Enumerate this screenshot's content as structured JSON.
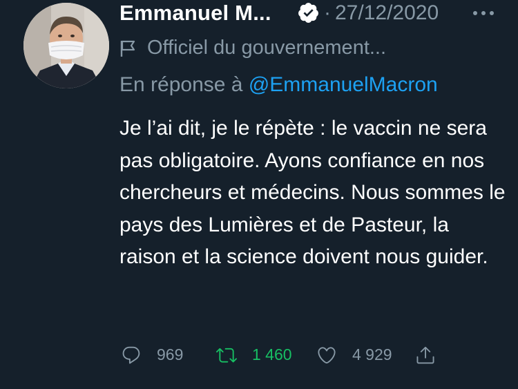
{
  "tweet": {
    "author_name": "Emmanuel M...",
    "date": "27/12/2020",
    "separator": "·",
    "government_label": "Officiel du gouvernement...",
    "reply_prefix": "En réponse à",
    "reply_handle": "@EmmanuelMacron",
    "text": "Je l’ai dit, je le répète : le vaccin ne sera pas obligatoire. Ayons confiance en nos chercheurs et médecins. Nous sommes le pays des Lumières et de Pasteur, la raison et la science doivent nous guider.",
    "verified": true
  },
  "actions": {
    "reply_count": "969",
    "retweet_count": "1 460",
    "like_count": "4 929",
    "retweeted": true
  },
  "icons": {
    "verified": "verified-badge-icon",
    "more": "more-options-icon",
    "flag": "flag-icon",
    "reply": "reply-icon",
    "retweet": "retweet-icon",
    "like": "heart-icon",
    "share": "share-icon"
  },
  "colors": {
    "background": "#15202b",
    "secondary_text": "#8899a6",
    "link": "#1da1f2",
    "retweet_active": "#17bf63",
    "primary_text": "#ffffff"
  }
}
